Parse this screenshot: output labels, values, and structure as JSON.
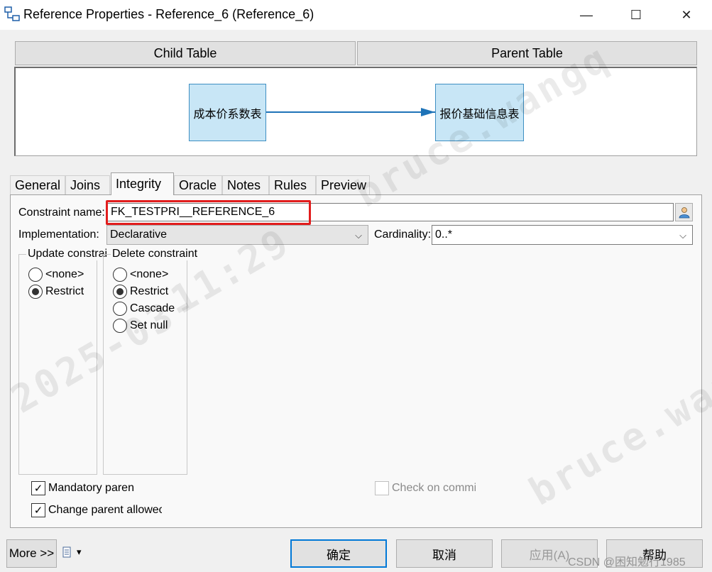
{
  "window": {
    "title": "Reference Properties - Reference_6 (Reference_6)",
    "minimize_glyph": "—",
    "maximize_glyph": "☐",
    "close_glyph": "✕"
  },
  "header": {
    "child_label": "Child Table",
    "parent_label": "Parent Table"
  },
  "diagram": {
    "child_table": "成本价系数表",
    "parent_table": "报价基础信息表"
  },
  "tabs": [
    {
      "label": "General"
    },
    {
      "label": "Joins"
    },
    {
      "label": "Integrity",
      "active": true
    },
    {
      "label": "Oracle"
    },
    {
      "label": "Notes"
    },
    {
      "label": "Rules"
    },
    {
      "label": "Preview"
    }
  ],
  "integrity": {
    "constraint_name_label": "Constraint name:",
    "constraint_name_value": "FK_TESTPRI__REFERENCE_6",
    "implementation_label": "Implementation:",
    "implementation_value": "Declarative",
    "cardinality_label": "Cardinality:",
    "cardinality_value": "0..*",
    "update_group": {
      "title": "Update constrai",
      "options": [
        {
          "label": "<none>",
          "checked": false
        },
        {
          "label": "Restrict",
          "checked": true
        }
      ]
    },
    "delete_group": {
      "title": "Delete constraint",
      "options": [
        {
          "label": "<none>",
          "checked": false
        },
        {
          "label": "Restrict",
          "checked": true
        },
        {
          "label": "Cascade",
          "checked": false
        },
        {
          "label": "Set null",
          "checked": false
        }
      ]
    },
    "mandatory_parent": {
      "label": "Mandatory paren",
      "checked": true
    },
    "change_parent": {
      "label": "Change parent allowec",
      "checked": true
    },
    "check_on_commit": {
      "label": "Check on commi",
      "checked": false,
      "disabled": true
    },
    "check_glyph": "✓",
    "chevron_glyph": "⌵"
  },
  "footer": {
    "more_label": "More >>",
    "ok_label": "确定",
    "cancel_label": "取消",
    "apply_label": "应用(A)",
    "help_label": "帮助",
    "dropdown_glyph": "▾"
  },
  "watermarks": {
    "credit": "CSDN @困知勉行1985",
    "text_a": "bruce.wangq",
    "text_b": "2025-03-",
    "text_c": "11:29",
    "text_d": "bruce.wang"
  },
  "colors": {
    "accent": "#0078d7",
    "highlight": "#e11d1d",
    "table_fill": "#c8e6f6",
    "link": "#1e73b8"
  }
}
